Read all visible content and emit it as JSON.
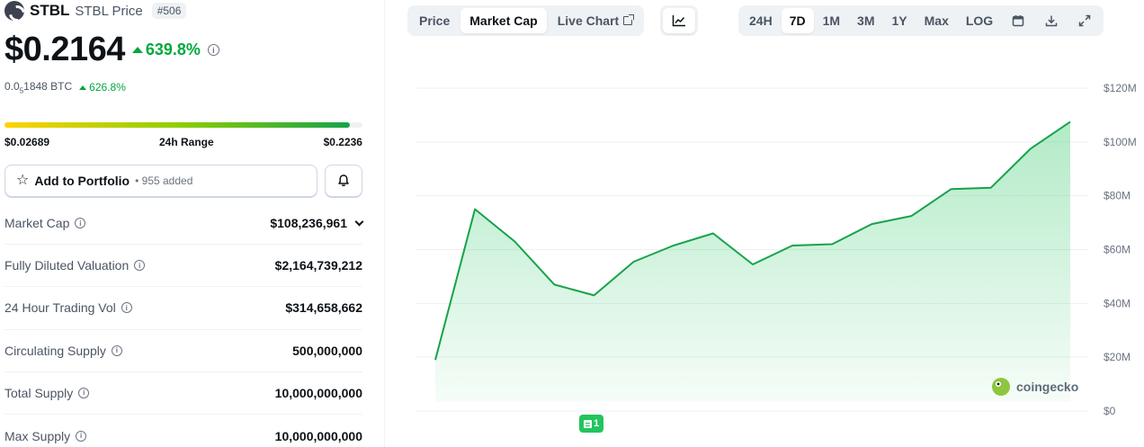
{
  "coin": {
    "symbol": "STBL",
    "name": "STBL Price",
    "rank": "#506",
    "price": "$0.2164",
    "change_24h": "639.8%",
    "btc_price_prefix": "0.0",
    "btc_price_sub": "5",
    "btc_price_rest": "1848 BTC",
    "btc_change": "626.8%"
  },
  "range_24h": {
    "low": "$0.02689",
    "label": "24h Range",
    "high": "$0.2236",
    "fill_fraction": 0.965
  },
  "portfolio": {
    "label": "Add to Portfolio",
    "count": "• 955 added"
  },
  "stats": [
    {
      "label": "Market Cap",
      "value": "$108,236,961",
      "dropdown": true
    },
    {
      "label": "Fully Diluted Valuation",
      "value": "$2,164,739,212"
    },
    {
      "label": "24 Hour Trading Vol",
      "value": "$314,658,662"
    },
    {
      "label": "Circulating Supply",
      "value": "500,000,000"
    },
    {
      "label": "Total Supply",
      "value": "10,000,000,000"
    },
    {
      "label": "Max Supply",
      "value": "10,000,000,000"
    }
  ],
  "chart_tabs": [
    "Price",
    "Market Cap",
    "Live Chart"
  ],
  "chart_tab_active": "Market Cap",
  "range_tabs": [
    "24H",
    "7D",
    "1M",
    "3M",
    "1Y",
    "Max",
    "LOG"
  ],
  "range_tab_active": "7D",
  "icons": {
    "chart_type": "line-chart-icon",
    "calendar": "calendar-icon",
    "download": "download-icon",
    "fullscreen": "expand-icon"
  },
  "colors": {
    "up": "#00a83e",
    "line": "#16a34a",
    "area": "#dcfce7"
  },
  "event_badge": "1",
  "watermark": "coingecko",
  "chart_data": {
    "type": "area",
    "title": "",
    "xlabel": "",
    "ylabel": "",
    "ylim": [
      0,
      120000000
    ],
    "y_ticks": [
      {
        "value": 0,
        "label": "$0"
      },
      {
        "value": 20000000,
        "label": "$20M"
      },
      {
        "value": 40000000,
        "label": "$40M"
      },
      {
        "value": 60000000,
        "label": "$60M"
      },
      {
        "value": 80000000,
        "label": "$80M"
      },
      {
        "value": 100000000,
        "label": "$100M"
      },
      {
        "value": 120000000,
        "label": "$120M"
      }
    ],
    "x_labels": [],
    "grid": true,
    "series": [
      {
        "values": [
          19000000,
          75000000,
          63000000,
          47000000,
          43000000,
          55500000,
          61500000,
          66000000,
          54500000,
          61500000,
          62000000,
          69500000,
          72500000,
          82500000,
          83000000,
          97500000,
          107500000
        ]
      }
    ]
  }
}
